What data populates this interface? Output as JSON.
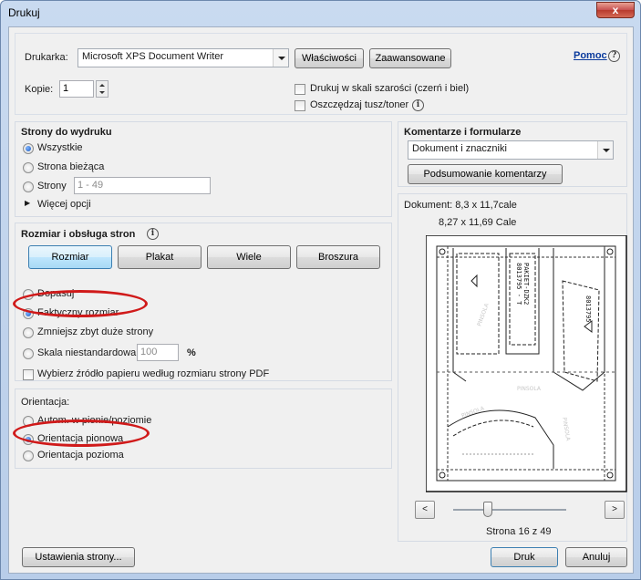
{
  "window": {
    "title": "Drukuj",
    "close_label": "x"
  },
  "printer": {
    "label": "Drukarka:",
    "selected": "Microsoft XPS Document Writer",
    "properties_button": "Właściwości",
    "advanced_button": "Zaawansowane",
    "help_link": "Pomoc",
    "copies_label": "Kopie:",
    "copies_value": "1",
    "grayscale_label": "Drukuj w skali szarości (czerń i biel)",
    "save_ink_label": "Oszczędzaj tusz/toner"
  },
  "pages_to_print": {
    "title": "Strony do wydruku",
    "all_label": "Wszystkie",
    "current_label": "Strona bieżąca",
    "pages_label": "Strony",
    "pages_value": "1 - 49",
    "more_options_label": "Więcej opcji"
  },
  "sizing": {
    "title": "Rozmiar i obsługa stron",
    "tabs": [
      {
        "label": "Rozmiar",
        "active": true
      },
      {
        "label": "Plakat",
        "active": false
      },
      {
        "label": "Wiele",
        "active": false
      },
      {
        "label": "Broszura",
        "active": false
      }
    ],
    "fit_label": "Dopasuj",
    "actual_size_label": "Faktyczny rozmiar",
    "shrink_label": "Zmniejsz zbyt duże strony",
    "custom_scale_label": "Skala niestandardowa:",
    "custom_scale_value": "100",
    "percent_label": "%",
    "paper_source_label": "Wybierz źródło papieru według rozmiaru strony PDF"
  },
  "orientation": {
    "title": "Orientacja:",
    "auto_label": "Autom. w pionie/poziomie",
    "portrait_label": "Orientacja pionowa",
    "landscape_label": "Orientacja pozioma"
  },
  "comments": {
    "title": "Komentarze i formularze",
    "selected": "Dokument i znaczniki",
    "summary_button": "Podsumowanie komentarzy"
  },
  "preview": {
    "document_size": "Dokument: 8,3 x 11,7cale",
    "page_size": "8,27 x 11,69 Cale",
    "prev_label": "<",
    "next_label": ">",
    "page_counter": "Strona 16 z 49",
    "page_progress": 0.31
  },
  "footer": {
    "page_setup_button": "Ustawienia strony...",
    "print_button": "Druk",
    "cancel_button": "Anuluj"
  },
  "colors": {
    "annotation_circle": "#d01a1a",
    "title_bar": "#c9daf0",
    "close_button": "#c75050"
  }
}
